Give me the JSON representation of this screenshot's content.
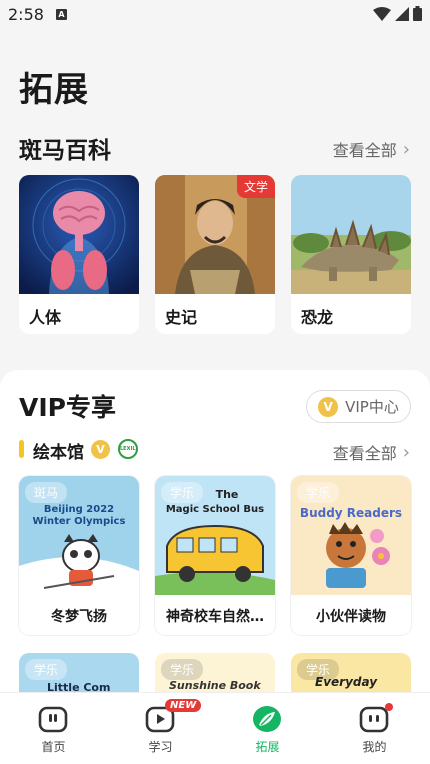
{
  "status_bar": {
    "time": "2:58",
    "notif_icon": "A"
  },
  "page_title": "拓展",
  "encyclopedia": {
    "title": "斑马百科",
    "see_all": "查看全部",
    "cards": [
      {
        "label": "人体",
        "icon": "human-body-image"
      },
      {
        "label": "史记",
        "icon": "history-warrior-image",
        "tag": "文学"
      },
      {
        "label": "恐龙",
        "icon": "stegosaurus-image"
      }
    ]
  },
  "vip": {
    "title": "VIP专享",
    "button_label": "VIP中心",
    "coin_letter": "V",
    "picture_books": {
      "title": "绘本馆",
      "v_badge": "V",
      "lexile_badge": "LEXILE",
      "see_all": "查看全部",
      "books": [
        {
          "chip": "斑马",
          "label": "冬梦飞扬",
          "cover_text_1": "Beijing 2022",
          "cover_text_2": "Winter Olympics",
          "color": "#9fd3ec"
        },
        {
          "chip": "学乐",
          "label": "神奇校车自然…",
          "cover_text_1": "The",
          "cover_text_2": "Magic School Bus",
          "color": "#bfe4f5"
        },
        {
          "chip": "学乐",
          "label": "小伙伴读物",
          "cover_text_1": "Buddy Readers",
          "cover_text_2": "",
          "color": "#fbe9c6"
        }
      ],
      "books_row2": [
        {
          "chip": "学乐",
          "cover_text": "Little Com",
          "color": "#a9d8ef"
        },
        {
          "chip": "学乐",
          "cover_text": "Sunshine Book",
          "color": "#fdf4d6"
        },
        {
          "chip": "学乐",
          "cover_text": "Everyday",
          "color": "#fbe7a4"
        }
      ]
    }
  },
  "nav": {
    "items": [
      {
        "label": "首页",
        "icon": "home-icon"
      },
      {
        "label": "学习",
        "icon": "study-icon",
        "badge": "NEW"
      },
      {
        "label": "拓展",
        "icon": "explore-icon",
        "active": true
      },
      {
        "label": "我的",
        "icon": "profile-icon"
      }
    ]
  },
  "colors": {
    "accent_green": "#15b563",
    "red": "#e53935",
    "gold": "#f0c24a"
  }
}
